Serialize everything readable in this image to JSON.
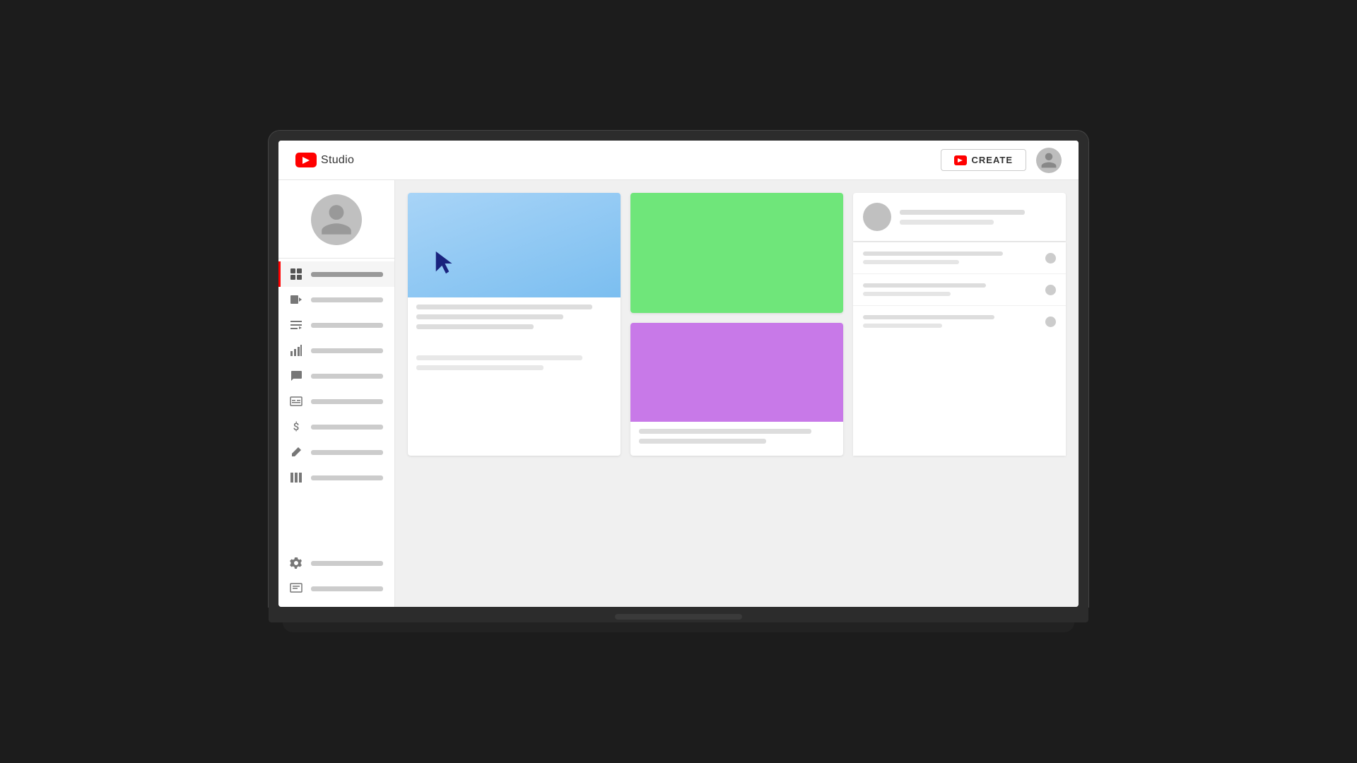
{
  "header": {
    "logo_text": "Studio",
    "create_button_label": "CREATE",
    "aria_youtube": "YouTube"
  },
  "sidebar": {
    "items": [
      {
        "id": "dashboard",
        "icon": "grid-icon",
        "active": true
      },
      {
        "id": "content",
        "icon": "video-icon",
        "active": false
      },
      {
        "id": "playlists",
        "icon": "list-icon",
        "active": false
      },
      {
        "id": "analytics",
        "icon": "analytics-icon",
        "active": false
      },
      {
        "id": "comments",
        "icon": "comment-icon",
        "active": false
      },
      {
        "id": "subtitles",
        "icon": "subtitles-icon",
        "active": false
      },
      {
        "id": "monetization",
        "icon": "dollar-icon",
        "active": false
      },
      {
        "id": "customization",
        "icon": "edit-icon",
        "active": false
      },
      {
        "id": "library",
        "icon": "library-icon",
        "active": false
      },
      {
        "id": "settings",
        "icon": "gear-icon",
        "active": false
      },
      {
        "id": "feedback",
        "icon": "feedback-icon",
        "active": false
      }
    ]
  },
  "cards": {
    "card1": {
      "thumbnail_color": "#8ec5f5",
      "has_cursor": true
    },
    "card2": {
      "thumbnail_color": "#6fe67a"
    },
    "card3": {
      "thumbnail_color": "#c879e8"
    }
  },
  "colors": {
    "red": "#ff0000",
    "sidebar_active_indicator": "#ff0000",
    "thumbnail_blue": "#8ec5f5",
    "thumbnail_green": "#6fe67a",
    "thumbnail_purple": "#c879e8",
    "line_color": "#d8d8d8",
    "card_bg": "#ffffff",
    "bg": "#f0f0f0"
  }
}
